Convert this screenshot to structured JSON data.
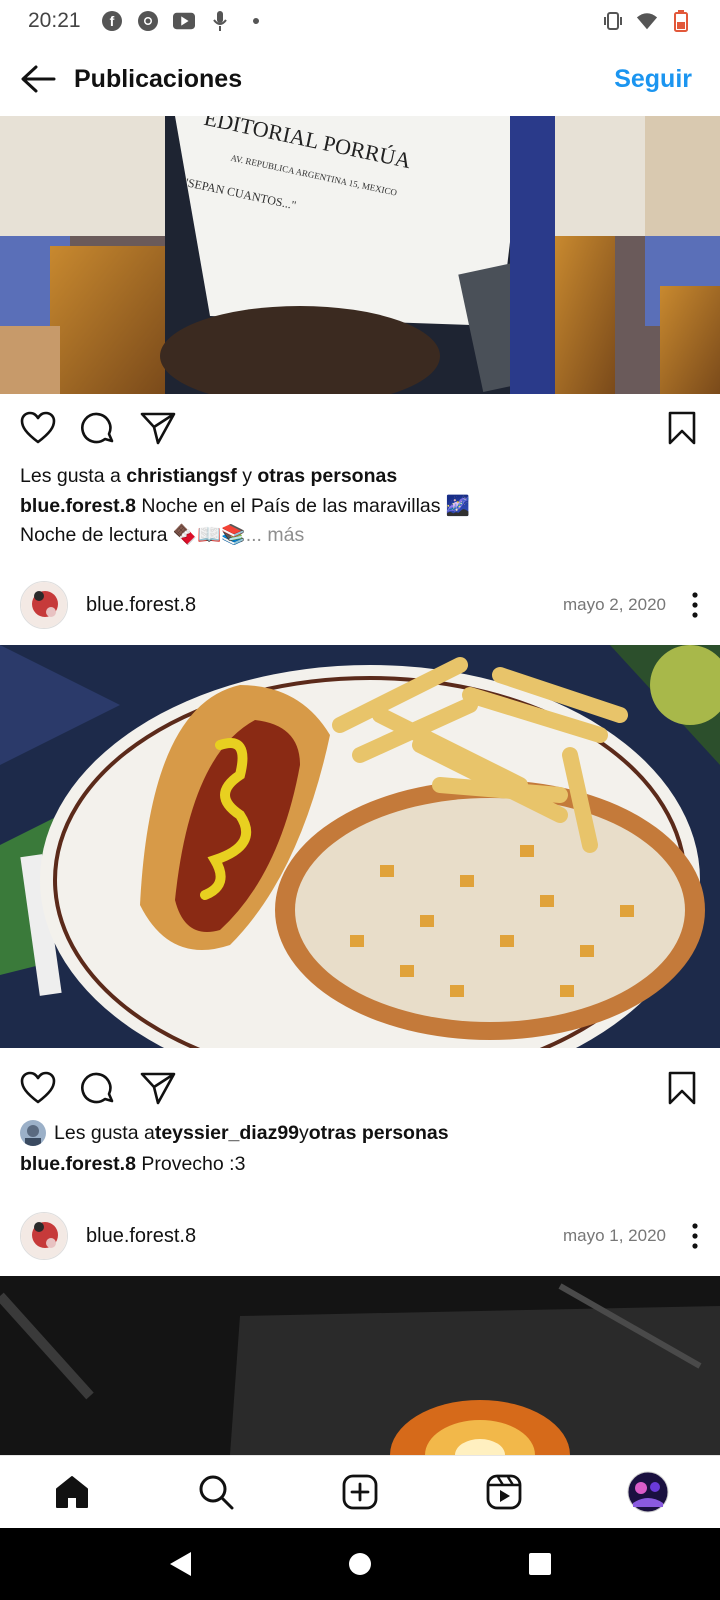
{
  "status_bar": {
    "time": "20:21",
    "icons_left": [
      "facebook-icon",
      "chrome-icon",
      "youtube-icon",
      "mic-icon",
      "dot-icon"
    ],
    "icons_right": [
      "vibrate-icon",
      "wifi-icon",
      "battery-low-icon"
    ]
  },
  "header": {
    "title": "Publicaciones",
    "follow_label": "Seguir",
    "accent_color": "#1b95f0"
  },
  "post1": {
    "likes_prefix": "Les gusta a ",
    "likes_user": "christiangsf",
    "likes_joiner": " y ",
    "likes_others": "otras personas",
    "caption_user": "blue.forest.8",
    "caption_line1": " Noche en el País de las maravillas 🌌",
    "caption_line2": "Noche de lectura 🍫📖📚",
    "more_label": "... más"
  },
  "post2": {
    "author": "blue.forest.8",
    "date": "mayo 2, 2020",
    "likes_prefix": "Les gusta a ",
    "likes_user": "teyssier_diaz99",
    "likes_joiner": " y ",
    "likes_others": "otras personas",
    "caption_user": "blue.forest.8",
    "caption_text": " Provecho :3"
  },
  "post3": {
    "author": "blue.forest.8",
    "date": "mayo 1, 2020"
  },
  "bottom_nav": [
    "home-icon",
    "search-icon",
    "create-icon",
    "reels-icon",
    "profile-avatar"
  ]
}
